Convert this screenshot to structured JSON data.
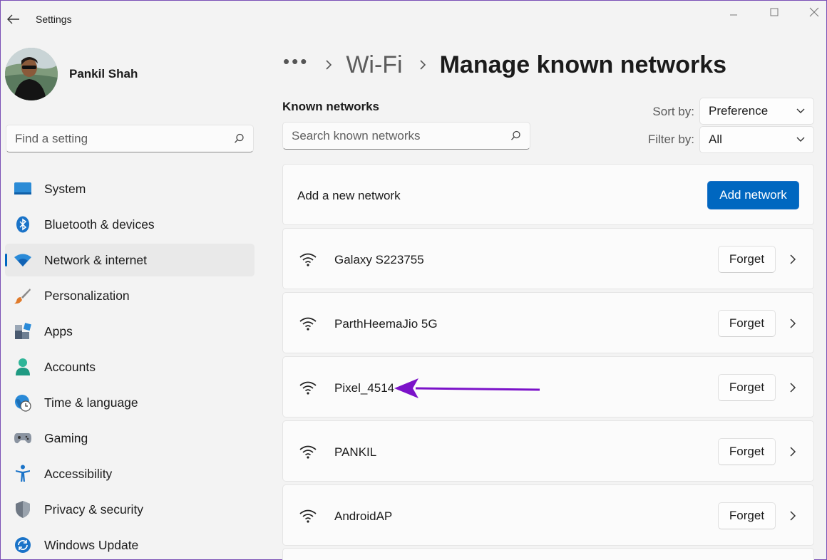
{
  "window": {
    "title": "Settings"
  },
  "user": {
    "name": "Pankil Shah"
  },
  "search": {
    "placeholder": "Find a setting"
  },
  "nav": [
    {
      "label": "System",
      "icon": "system-icon"
    },
    {
      "label": "Bluetooth & devices",
      "icon": "bluetooth-icon"
    },
    {
      "label": "Network & internet",
      "icon": "wifi-icon",
      "active": true
    },
    {
      "label": "Personalization",
      "icon": "brush-icon"
    },
    {
      "label": "Apps",
      "icon": "apps-icon"
    },
    {
      "label": "Accounts",
      "icon": "person-icon"
    },
    {
      "label": "Time & language",
      "icon": "globe-clock-icon"
    },
    {
      "label": "Gaming",
      "icon": "gamepad-icon"
    },
    {
      "label": "Accessibility",
      "icon": "accessibility-icon"
    },
    {
      "label": "Privacy & security",
      "icon": "shield-icon"
    },
    {
      "label": "Windows Update",
      "icon": "update-icon"
    }
  ],
  "breadcrumb": {
    "more": "•••",
    "parent": "Wi-Fi",
    "current": "Manage known networks"
  },
  "known": {
    "title": "Known networks",
    "search_placeholder": "Search known networks",
    "sort_label": "Sort by:",
    "sort_value": "Preference",
    "filter_label": "Filter by:",
    "filter_value": "All",
    "add_label": "Add a new network",
    "add_button": "Add network",
    "forget_label": "Forget",
    "networks": [
      {
        "name": "Galaxy S223755"
      },
      {
        "name": "ParthHeemaJio 5G"
      },
      {
        "name": "Pixel_4514"
      },
      {
        "name": "PANKIL"
      },
      {
        "name": "AndroidAP"
      }
    ]
  },
  "colors": {
    "accent": "#0067c0",
    "annotation_arrow": "#7b12c9"
  }
}
